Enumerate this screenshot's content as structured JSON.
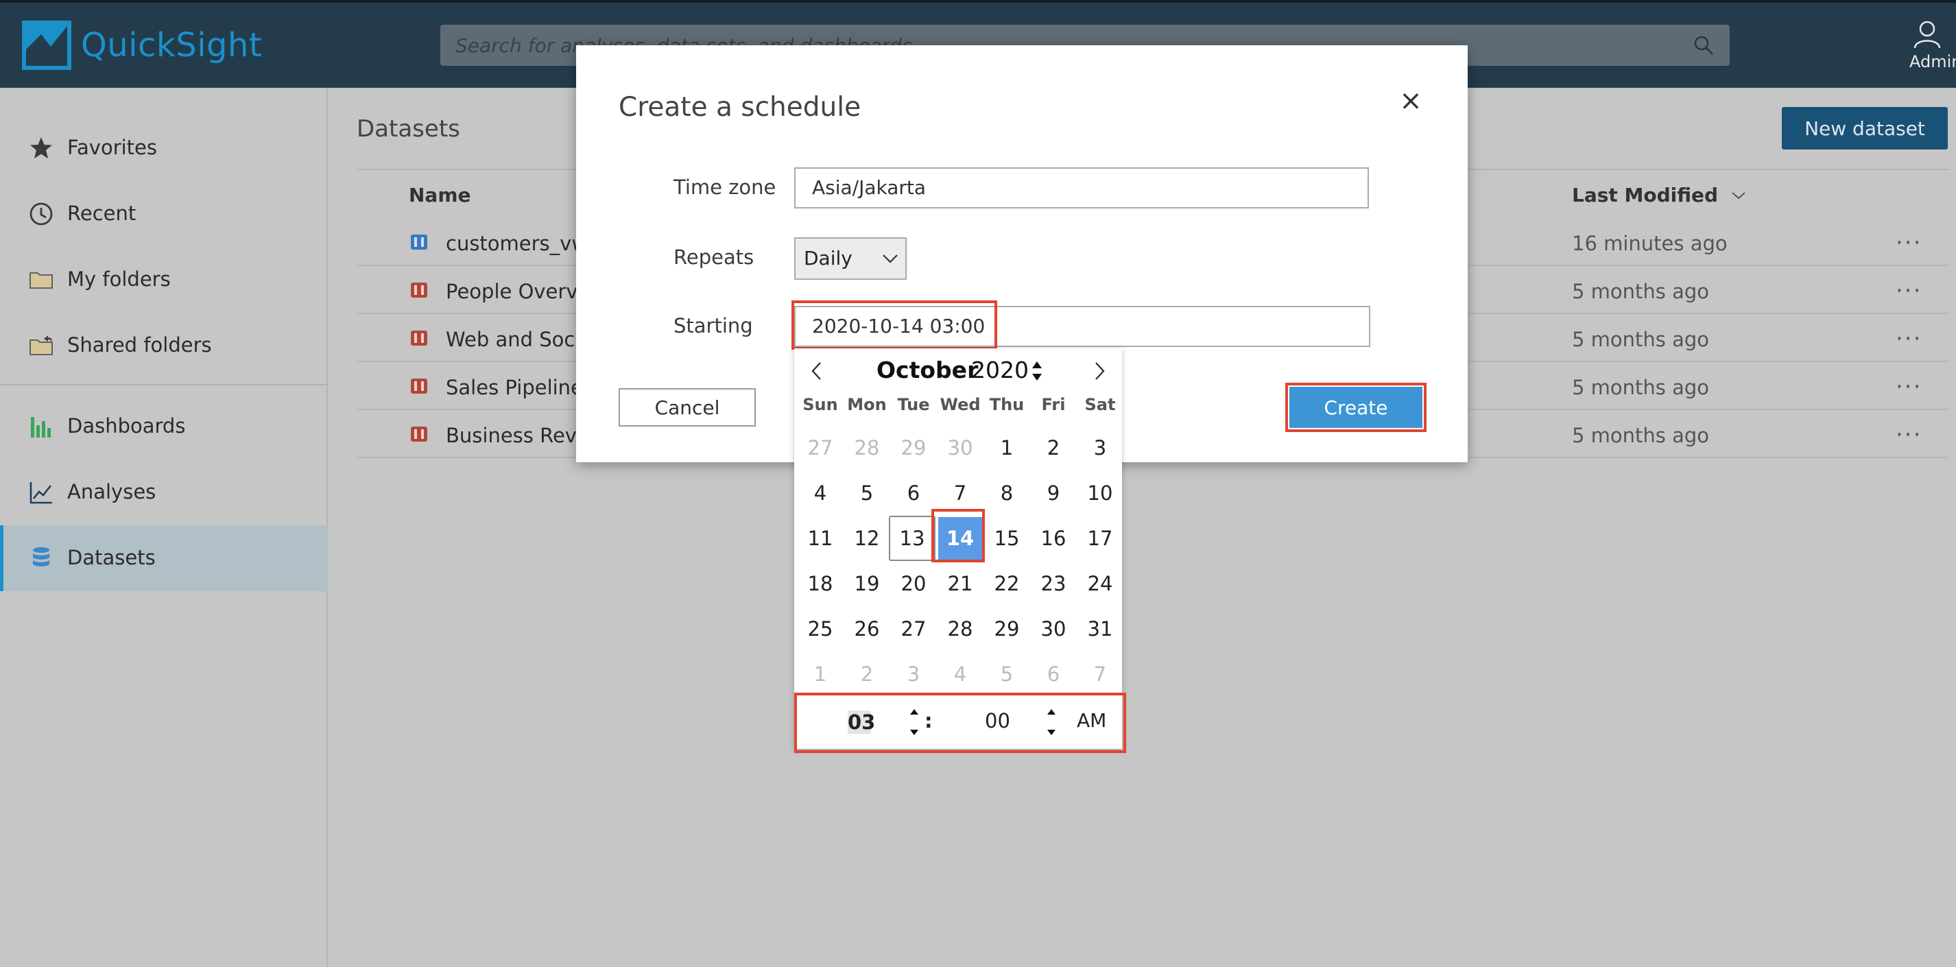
{
  "app": {
    "brand_name": "QuickSight",
    "brand_color": "#1a91c9",
    "header_color": "#243b4c"
  },
  "search": {
    "placeholder": "Search for analyses, data sets, and dashboards",
    "icon": "search-icon"
  },
  "user": {
    "label": "Admin",
    "icon": "user-icon"
  },
  "sidebar": {
    "items": [
      {
        "label": "Favorites",
        "icon": "star-icon"
      },
      {
        "label": "Recent",
        "icon": "clock-icon"
      },
      {
        "label": "My folders",
        "icon": "folder-icon"
      },
      {
        "label": "Shared folders",
        "icon": "shared-folder-icon"
      },
      {
        "label": "Dashboards",
        "icon": "bar-chart-icon"
      },
      {
        "label": "Analyses",
        "icon": "line-chart-icon"
      },
      {
        "label": "Datasets",
        "icon": "database-icon",
        "active": true
      }
    ]
  },
  "main": {
    "title": "Datasets",
    "new_dataset_label": "New dataset",
    "columns": {
      "name": "Name",
      "last_modified": "Last Modified"
    },
    "rows": [
      {
        "name": "customers_vw",
        "modified": "16 minutes ago",
        "icon": "dataset-blue-icon"
      },
      {
        "name": "People Overvie",
        "modified": "5 months ago",
        "icon": "dataset-red-icon"
      },
      {
        "name": "Web and Social",
        "modified": "5 months ago",
        "icon": "dataset-red-icon"
      },
      {
        "name": "Sales Pipeline",
        "modified": "5 months ago",
        "icon": "dataset-red-icon"
      },
      {
        "name": "Business Reviev",
        "modified": "5 months ago",
        "icon": "dataset-red-icon"
      }
    ],
    "more_label": "···"
  },
  "modal": {
    "title": "Create a schedule",
    "close_label": "×",
    "time_zone_label": "Time zone",
    "time_zone_value": "Asia/Jakarta",
    "repeats_label": "Repeats",
    "repeats_value": "Daily",
    "starting_label": "Starting",
    "starting_value": "2020-10-14 03:00",
    "cancel_label": "Cancel",
    "create_label": "Create",
    "create_color": "#3d95d6",
    "highlight_color": "#e0452e"
  },
  "datepicker": {
    "month": "October",
    "year": "2020",
    "weekdays": [
      "Sun",
      "Mon",
      "Tue",
      "Wed",
      "Thu",
      "Fri",
      "Sat"
    ],
    "weeks": [
      [
        "27",
        "28",
        "29",
        "30",
        "1",
        "2",
        "3"
      ],
      [
        "4",
        "5",
        "6",
        "7",
        "8",
        "9",
        "10"
      ],
      [
        "11",
        "12",
        "13",
        "14",
        "15",
        "16",
        "17"
      ],
      [
        "18",
        "19",
        "20",
        "21",
        "22",
        "23",
        "24"
      ],
      [
        "25",
        "26",
        "27",
        "28",
        "29",
        "30",
        "31"
      ],
      [
        "1",
        "2",
        "3",
        "4",
        "5",
        "6",
        "7"
      ]
    ],
    "today": "13",
    "selected": "14",
    "selected_color": "#5b9be6",
    "hour": "03",
    "minute": "00",
    "separator": ":",
    "ampm": "AM"
  }
}
